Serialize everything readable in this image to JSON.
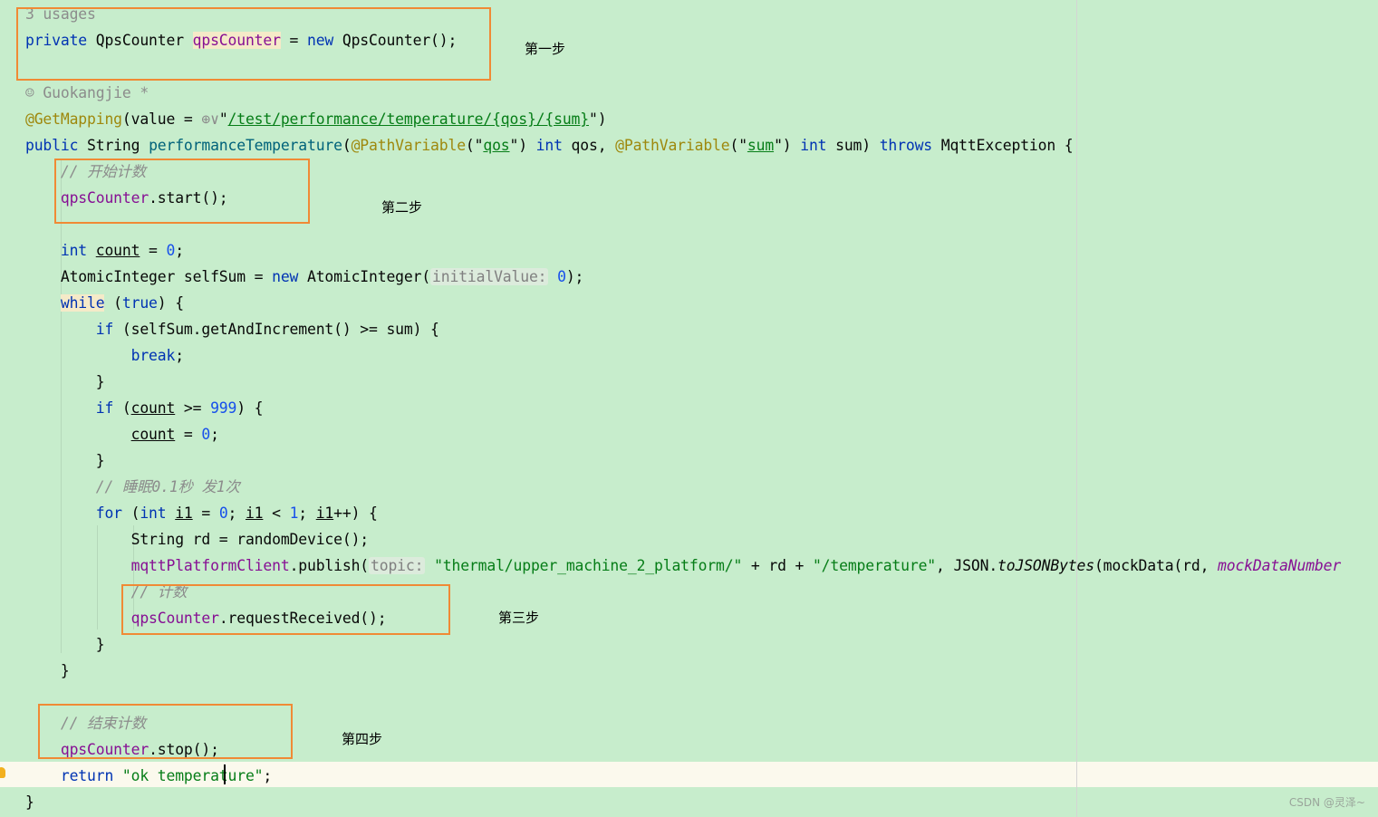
{
  "colors": {
    "background": "#c7edcc",
    "keyword": "#0033b3",
    "string": "#067d17",
    "number": "#1750eb",
    "field": "#871094",
    "annotation": "#9e880d",
    "comment": "#8c8c8c",
    "annotation_box": "#f08a35"
  },
  "code": [
    [
      {
        "t": "3 usages",
        "c": "gray"
      }
    ],
    [
      {
        "t": "private ",
        "c": "kw"
      },
      {
        "t": "QpsCounter "
      },
      {
        "t": "qpsCounter",
        "c": "field usage"
      },
      {
        "t": " = "
      },
      {
        "t": "new ",
        "c": "kw"
      },
      {
        "t": "QpsCounter();"
      }
    ],
    [],
    [
      {
        "t": "☺ Guokangjie *",
        "c": "gray"
      }
    ],
    [
      {
        "t": "@GetMapping",
        "c": "ann"
      },
      {
        "t": "(value = "
      },
      {
        "t": "⊕∨",
        "c": "gray"
      },
      {
        "t": "\""
      },
      {
        "t": "/test/performance/temperature/{qos}/{sum}",
        "c": "str u"
      },
      {
        "t": "\")"
      }
    ],
    [
      {
        "t": "public ",
        "c": "kw"
      },
      {
        "t": "String "
      },
      {
        "t": "performanceTemperature",
        "c": "fn"
      },
      {
        "t": "("
      },
      {
        "t": "@PathVariable",
        "c": "ann"
      },
      {
        "t": "(\""
      },
      {
        "t": "qos",
        "c": "str u"
      },
      {
        "t": "\") "
      },
      {
        "t": "int ",
        "c": "kw"
      },
      {
        "t": "qos, "
      },
      {
        "t": "@PathVariable",
        "c": "ann"
      },
      {
        "t": "(\""
      },
      {
        "t": "sum",
        "c": "str u"
      },
      {
        "t": "\") "
      },
      {
        "t": "int ",
        "c": "kw"
      },
      {
        "t": "sum) "
      },
      {
        "t": "throws ",
        "c": "kw"
      },
      {
        "t": "MqttException {"
      }
    ],
    [
      {
        "t": "    "
      },
      {
        "t": "// 开始计数",
        "c": "cmt"
      }
    ],
    [
      {
        "t": "    "
      },
      {
        "t": "qpsCounter",
        "c": "field"
      },
      {
        "t": ".start();"
      }
    ],
    [],
    [
      {
        "t": "    "
      },
      {
        "t": "int ",
        "c": "kw"
      },
      {
        "t": "count",
        "c": "u"
      },
      {
        "t": " = "
      },
      {
        "t": "0",
        "c": "num"
      },
      {
        "t": ";"
      }
    ],
    [
      {
        "t": "    AtomicInteger selfSum = "
      },
      {
        "t": "new ",
        "c": "kw"
      },
      {
        "t": "AtomicInteger("
      },
      {
        "t": "initialValue:",
        "c": "hint"
      },
      {
        "t": " "
      },
      {
        "t": "0",
        "c": "num"
      },
      {
        "t": ");"
      }
    ],
    [
      {
        "t": "    "
      },
      {
        "t": "while",
        "c": "kw usage"
      },
      {
        "t": " ("
      },
      {
        "t": "true",
        "c": "kw"
      },
      {
        "t": ") {"
      }
    ],
    [
      {
        "t": "        "
      },
      {
        "t": "if ",
        "c": "kw"
      },
      {
        "t": "(selfSum.getAndIncrement() >= sum) {"
      }
    ],
    [
      {
        "t": "            "
      },
      {
        "t": "break",
        "c": "kw"
      },
      {
        "t": ";"
      }
    ],
    [
      {
        "t": "        }"
      }
    ],
    [
      {
        "t": "        "
      },
      {
        "t": "if ",
        "c": "kw"
      },
      {
        "t": "("
      },
      {
        "t": "count",
        "c": "u"
      },
      {
        "t": " >= "
      },
      {
        "t": "999",
        "c": "num"
      },
      {
        "t": ") {"
      }
    ],
    [
      {
        "t": "            "
      },
      {
        "t": "count",
        "c": "u"
      },
      {
        "t": " = "
      },
      {
        "t": "0",
        "c": "num"
      },
      {
        "t": ";"
      }
    ],
    [
      {
        "t": "        }"
      }
    ],
    [
      {
        "t": "        "
      },
      {
        "t": "// 睡眠0.1秒 发1次",
        "c": "cmt"
      }
    ],
    [
      {
        "t": "        "
      },
      {
        "t": "for ",
        "c": "kw"
      },
      {
        "t": "("
      },
      {
        "t": "int ",
        "c": "kw"
      },
      {
        "t": "i1",
        "c": "u"
      },
      {
        "t": " = "
      },
      {
        "t": "0",
        "c": "num"
      },
      {
        "t": "; "
      },
      {
        "t": "i1",
        "c": "u"
      },
      {
        "t": " < "
      },
      {
        "t": "1",
        "c": "num"
      },
      {
        "t": "; "
      },
      {
        "t": "i1",
        "c": "u"
      },
      {
        "t": "++) {"
      }
    ],
    [
      {
        "t": "            String rd = randomDevice();"
      }
    ],
    [
      {
        "t": "            "
      },
      {
        "t": "mqttPlatformClient",
        "c": "field"
      },
      {
        "t": ".publish("
      },
      {
        "t": "topic:",
        "c": "hint"
      },
      {
        "t": " "
      },
      {
        "t": "\"thermal/upper_machine_2_platform/\"",
        "c": "str"
      },
      {
        "t": " + rd + "
      },
      {
        "t": "\"/temperature\"",
        "c": "str"
      },
      {
        "t": ", JSON."
      },
      {
        "t": "toJSONBytes",
        "c": "ital"
      },
      {
        "t": "(mockData(rd, "
      },
      {
        "t": "mockDataNumber",
        "c": "field ital"
      }
    ],
    [
      {
        "t": "            "
      },
      {
        "t": "// 计数",
        "c": "cmt"
      }
    ],
    [
      {
        "t": "            "
      },
      {
        "t": "qpsCounter",
        "c": "field"
      },
      {
        "t": ".requestReceived();"
      }
    ],
    [
      {
        "t": "        }"
      }
    ],
    [
      {
        "t": "    }"
      }
    ],
    [],
    [
      {
        "t": "    "
      },
      {
        "t": "// 结束计数",
        "c": "cmt"
      }
    ],
    [
      {
        "t": "    "
      },
      {
        "t": "qpsCounter",
        "c": "field"
      },
      {
        "t": ".stop();"
      }
    ],
    [
      {
        "t": "    "
      },
      {
        "t": "return ",
        "c": "kw"
      },
      {
        "t": "\"ok temperature\"",
        "c": "str"
      },
      {
        "t": ";"
      }
    ],
    [
      {
        "t": "}"
      }
    ]
  ],
  "steps": {
    "step1": "第一步",
    "step2": "第二步",
    "step3": "第三步",
    "step4": "第四步"
  },
  "watermark": "CSDN @灵泽~"
}
